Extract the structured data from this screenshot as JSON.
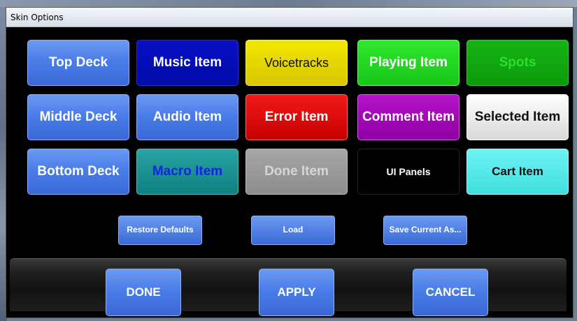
{
  "window": {
    "title": "Skin Options"
  },
  "skins": {
    "top_deck": "Top Deck",
    "music_item": "Music Item",
    "voicetracks": "Voicetracks",
    "playing_item": "Playing Item",
    "spots": "Spots",
    "middle_deck": "Middle Deck",
    "audio_item": "Audio Item",
    "error_item": "Error Item",
    "comment_item": "Comment Item",
    "selected_item": "Selected Item",
    "bottom_deck": "Bottom Deck",
    "macro_item": "Macro Item",
    "done_item": "Done Item",
    "ui_panels": "UI Panels",
    "cart_item": "Cart Item"
  },
  "actions": {
    "restore_defaults": "Restore Defaults",
    "load": "Load",
    "save_current_as": "Save Current As..."
  },
  "footer": {
    "done": "DONE",
    "apply": "APPLY",
    "cancel": "CANCEL"
  },
  "colors": {
    "button_blue": "#4a7de8",
    "music": "#000da8",
    "voicetracks": "#e4d400",
    "playing": "#22d622",
    "spots": "#0ea60e",
    "error": "#d80a0a",
    "comment": "#a008b8",
    "selected": "#ececec",
    "macro": "#1a9090",
    "done_item": "#999999",
    "ui_panels": "#000000",
    "cart": "#55e8e8"
  }
}
